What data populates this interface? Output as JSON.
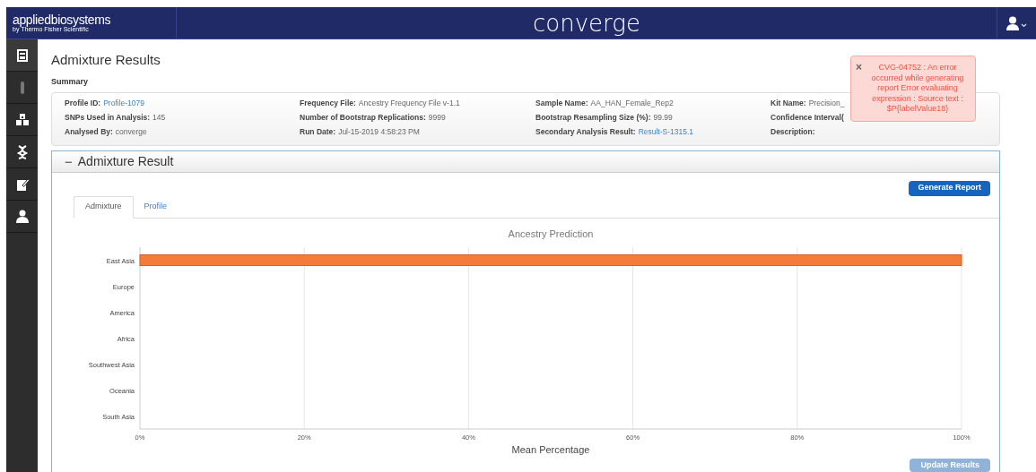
{
  "header": {
    "brand": "appliedbiosystems",
    "brand_sub": "by Thermo Fisher Scientific",
    "app_title": "converge"
  },
  "sidebar": {
    "items": [
      {
        "selected": true
      },
      {
        "selected": false
      },
      {
        "selected": false
      },
      {
        "selected": false
      },
      {
        "selected": false
      },
      {
        "selected": false
      }
    ]
  },
  "page_title": "Admixture Results",
  "summary": {
    "label": "Summary",
    "columns": [
      [
        {
          "label": "Profile ID:",
          "value": "Profile-1079",
          "link": true
        },
        {
          "label": "SNPs Used in Analysis:",
          "value": "145",
          "link": false
        },
        {
          "label": "Analysed By:",
          "value": "converge",
          "link": false
        }
      ],
      [
        {
          "label": "Frequency File:",
          "value": "Ancestry Frequency File v-1.1",
          "link": false
        },
        {
          "label": "Number of Bootstrap Replications:",
          "value": "9999",
          "link": false
        },
        {
          "label": "Run Date:",
          "value": "Jul-15-2019 4:58:23 PM",
          "link": false
        }
      ],
      [
        {
          "label": "Sample Name:",
          "value": "AA_HAN_Female_Rep2",
          "link": false
        },
        {
          "label": "Bootstrap Resampling Size (%):",
          "value": "99.99",
          "link": false
        },
        {
          "label": "Secondary Analysis Result:",
          "value": "Result-S-1315.1",
          "link": true
        }
      ],
      [
        {
          "label": "Kit Name:",
          "value": "Precision_",
          "link": false
        },
        {
          "label": "Confidence Interval("
        },
        {
          "label": "Description:"
        }
      ]
    ]
  },
  "error_toast": {
    "close": "×",
    "message": "CVG-04752 : An error occurred while generating report Error evaluating expression : Source text : $P{labelValue18}"
  },
  "panel": {
    "toggle": "−",
    "title": "Admixture Result",
    "generate_button": "Generate Report",
    "update_button": "Update Results",
    "tabs": [
      {
        "label": "Admixture",
        "selected": true
      },
      {
        "label": "Profile",
        "selected": false
      }
    ],
    "chart_data": {
      "type": "bar",
      "orientation": "horizontal",
      "title": "Ancestry Prediction",
      "xlabel": "Mean Percentage",
      "categories": [
        "East Asia",
        "Europe",
        "America",
        "Africa",
        "Southwest Asia",
        "Oceania",
        "South Asia"
      ],
      "grid": true,
      "series": [
        {
          "color": "#f47b3a",
          "values": [
            100,
            0,
            0,
            0,
            0,
            0,
            0
          ]
        }
      ],
      "xlim": [
        0,
        100
      ],
      "xticks": [
        {
          "value": 0,
          "label": "0%"
        },
        {
          "value": 20,
          "label": "20%"
        },
        {
          "value": 40,
          "label": "40%"
        },
        {
          "value": 60,
          "label": "60%"
        },
        {
          "value": 80,
          "label": "80%"
        },
        {
          "value": 100,
          "label": "100%"
        }
      ]
    }
  }
}
